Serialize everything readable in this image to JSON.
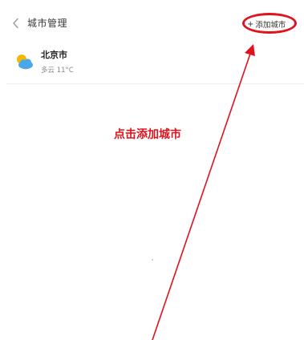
{
  "header": {
    "title": "城市管理",
    "back_icon": "chevron-left-icon",
    "add_city_plus": "+",
    "add_city_label": "添加城市"
  },
  "cities": [
    {
      "name": "北京市",
      "weather": "多云 11°C",
      "icon": "partly-cloudy-icon"
    }
  ],
  "annotation": {
    "text": "点击添加城市",
    "color": "#e0121b"
  },
  "colors": {
    "accent": "#e0121b",
    "sun": "#f5b800",
    "cloud": "#4aa8e8"
  }
}
